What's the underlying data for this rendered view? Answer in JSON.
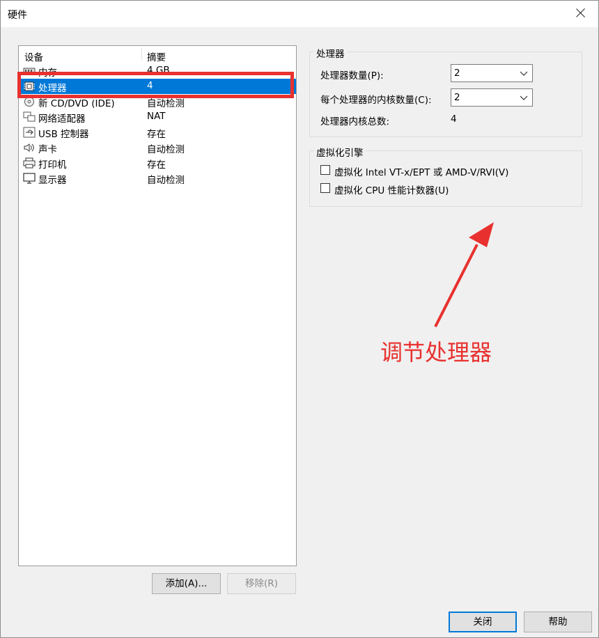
{
  "window": {
    "title": "硬件"
  },
  "device_list": {
    "header_device": "设备",
    "header_summary": "摘要",
    "items": [
      {
        "icon": "memory-icon",
        "name": "内存",
        "summary": "4 GB"
      },
      {
        "icon": "processor-icon",
        "name": "处理器",
        "summary": "4",
        "selected": true
      },
      {
        "icon": "cd-dvd-icon",
        "name": "新 CD/DVD (IDE)",
        "summary": "自动检测"
      },
      {
        "icon": "network-adapter-icon",
        "name": "网络适配器",
        "summary": "NAT"
      },
      {
        "icon": "usb-icon",
        "name": "USB 控制器",
        "summary": "存在"
      },
      {
        "icon": "sound-card-icon",
        "name": "声卡",
        "summary": "自动检测"
      },
      {
        "icon": "printer-icon",
        "name": "打印机",
        "summary": "存在"
      },
      {
        "icon": "display-icon",
        "name": "显示器",
        "summary": "自动检测"
      }
    ],
    "add_label": "添加(A)...",
    "remove_label": "移除(R)"
  },
  "processor_group": {
    "title": "处理器",
    "count_label": "处理器数量(P):",
    "count_value": "2",
    "cores_label": "每个处理器的内核数量(C):",
    "cores_value": "2",
    "total_label": "处理器内核总数:",
    "total_value": "4"
  },
  "virtualization_group": {
    "title": "虚拟化引擎",
    "option1": "虚拟化 Intel VT-x/EPT 或 AMD-V/RVI(V)",
    "option2": "虚拟化 CPU 性能计数器(U)"
  },
  "annotation": {
    "text": "调节处理器",
    "color": "#e8312f"
  },
  "footer": {
    "close_label": "关闭",
    "help_label": "帮助"
  },
  "colors": {
    "accent": "#0078d7",
    "highlight": "#e8312f"
  }
}
